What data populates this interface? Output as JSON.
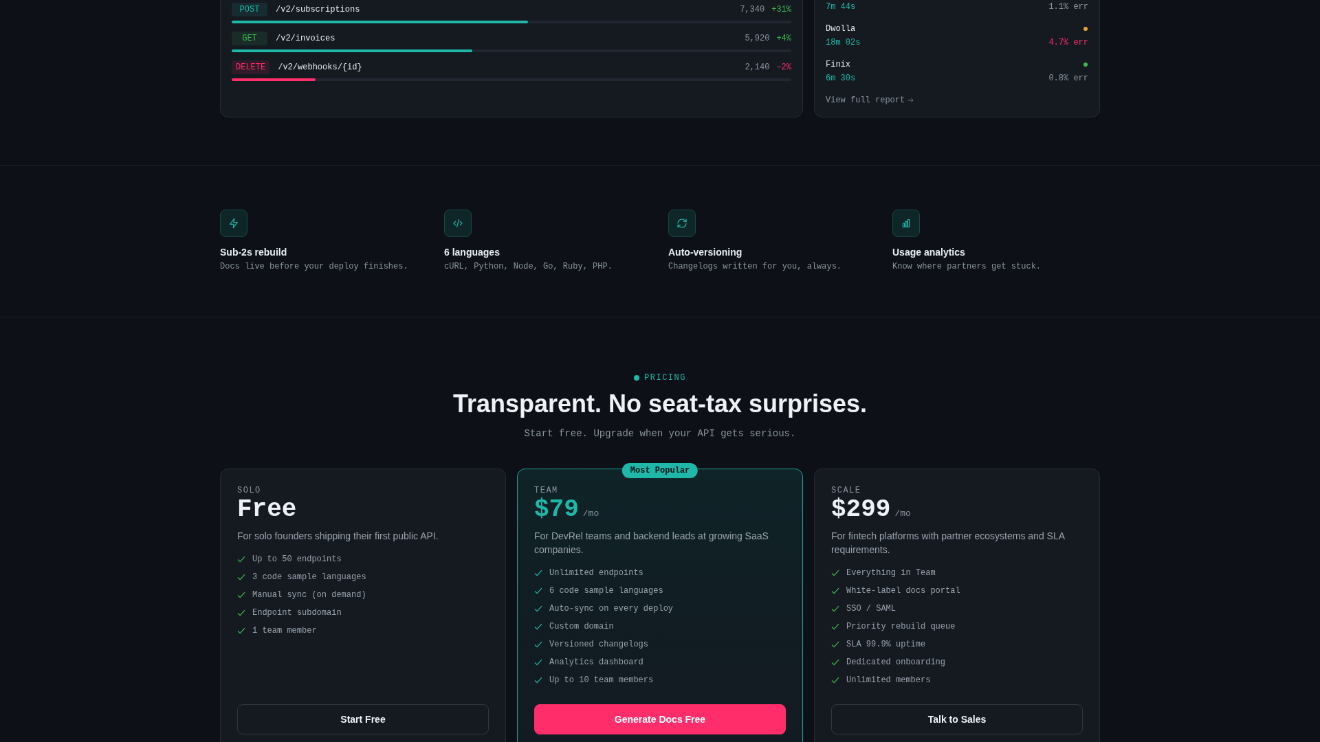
{
  "endpoints": {
    "rows": [
      {
        "method": "POST",
        "color": "#1fb8a8",
        "path": "/v2/subscriptions",
        "count": "7,340",
        "change": "+31%",
        "negative": false,
        "level": 0.53
      },
      {
        "method": "GET",
        "color": "#3fb950",
        "path": "/v2/invoices",
        "count": "5,920",
        "change": "+4%",
        "negative": false,
        "level": 0.43
      },
      {
        "method": "DELETE",
        "color": "#ff2d6a",
        "path": "/v2/webhooks/{id}",
        "count": "2,140",
        "change": "−2%",
        "negative": true,
        "level": 0.15
      }
    ]
  },
  "partners": {
    "items": [
      {
        "time": "7m 44s",
        "error": "1.1% err",
        "alert": false
      },
      {
        "name": "Dwolla",
        "color": "#e3a52b",
        "time": "18m 02s",
        "error": "4.7% err",
        "alert": true
      },
      {
        "name": "Finix",
        "color": "#3fb950",
        "time": "6m 30s",
        "error": "0.8% err",
        "alert": false
      }
    ],
    "link": "View full report"
  },
  "features": [
    {
      "title": "Sub-2s rebuild",
      "description": "Docs live before your deploy finishes."
    },
    {
      "title": "6 languages",
      "description": "cURL, Python, Node, Go, Ruby, PHP."
    },
    {
      "title": "Auto-versioning",
      "description": "Changelogs written for you, always."
    },
    {
      "title": "Usage analytics",
      "description": "Know where partners get stuck."
    }
  ],
  "pricing": {
    "eyebrow": "PRICING",
    "title": "Transparent. No seat-tax surprises.",
    "subtitle": "Start free. Upgrade when your API gets serious.",
    "plans": [
      {
        "tier": "SOLO",
        "price": "Free",
        "featured": false,
        "description": "For solo founders shipping their first public API.",
        "features": [
          "Up to 50 endpoints",
          "3 code sample languages",
          "Manual sync (on demand)",
          "Endpoint subdomain",
          "1 team member"
        ],
        "button": "Start Free"
      },
      {
        "tier": "TEAM",
        "badge": "Most Popular",
        "price": "$79",
        "period": "/mo",
        "featured": true,
        "description": "For DevRel teams and backend leads at growing SaaS companies.",
        "features": [
          "Unlimited endpoints",
          "6 code sample languages",
          "Auto-sync on every deploy",
          "Custom domain",
          "Versioned changelogs",
          "Analytics dashboard",
          "Up to 10 team members"
        ],
        "button": "Generate Docs Free"
      },
      {
        "tier": "SCALE",
        "price": "$299",
        "period": "/mo",
        "featured": false,
        "description": "For fintech platforms with partner ecosystems and SLA requirements.",
        "features": [
          "Everything in Team",
          "White-label docs portal",
          "SSO / SAML",
          "Priority rebuild queue",
          "SLA 99.9% uptime",
          "Dedicated onboarding",
          "Unlimited members"
        ],
        "button": "Talk to Sales"
      }
    ]
  }
}
